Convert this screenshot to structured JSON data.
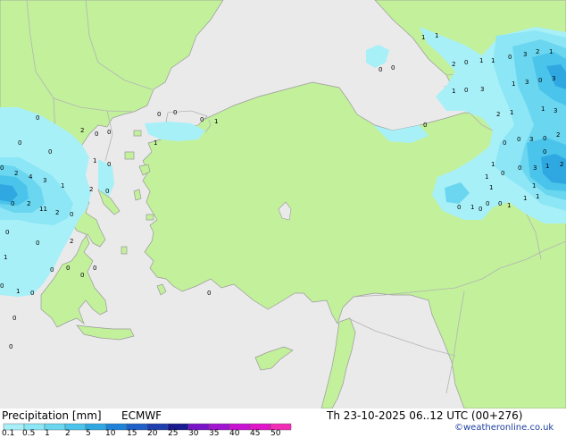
{
  "header": {
    "product_label": "Precipitation [mm]",
    "model_label": "ECMWF",
    "valid_time": "Th 23-10-2025 06..12 UTC (00+276)",
    "credit": "©weatheronline.co.uk"
  },
  "legend": {
    "labels": [
      "0.1",
      "0.5",
      "1",
      "2",
      "5",
      "10",
      "15",
      "20",
      "25",
      "30",
      "35",
      "40",
      "45",
      "50"
    ],
    "colors": [
      "#a8f0f8",
      "#8ce6f5",
      "#6ad6ef",
      "#4ac4ea",
      "#2fa8e2",
      "#1e82d8",
      "#1f5fc8",
      "#1e3fae",
      "#1a1a90",
      "#7a14c8",
      "#a014d2",
      "#c814d2",
      "#e014c8",
      "#f02db4"
    ]
  },
  "colors": {
    "land": "#c2f09b",
    "sea": "#eaeaea",
    "border": "#b4b4b4",
    "coast": "#9a9a9a"
  },
  "map_values": [
    "1",
    "1",
    "0",
    "0",
    "2",
    "0",
    "1",
    "1",
    "0",
    "3",
    "2",
    "1",
    "1",
    "3",
    "0",
    "3",
    "1",
    "0",
    "3",
    "1",
    "3",
    "2",
    "1",
    "0",
    "3",
    "0",
    "2",
    "0",
    "0",
    "3",
    "1",
    "2",
    "1",
    "0",
    "1",
    "1",
    "1",
    "0",
    "1",
    "0",
    "0",
    "0",
    "0",
    "0",
    "1",
    "0",
    "0",
    "2",
    "0",
    "1",
    "0",
    "0",
    "2",
    "4",
    "3",
    "1",
    "11",
    "2",
    "0",
    "2",
    "1",
    "0",
    "2",
    "0",
    "0",
    "1",
    "0",
    "0",
    "0",
    "0",
    "0",
    "0",
    "0",
    "1",
    "0",
    "0",
    "0",
    "2",
    "0",
    "0",
    "0",
    "1",
    "1",
    "0",
    "1",
    "0"
  ]
}
